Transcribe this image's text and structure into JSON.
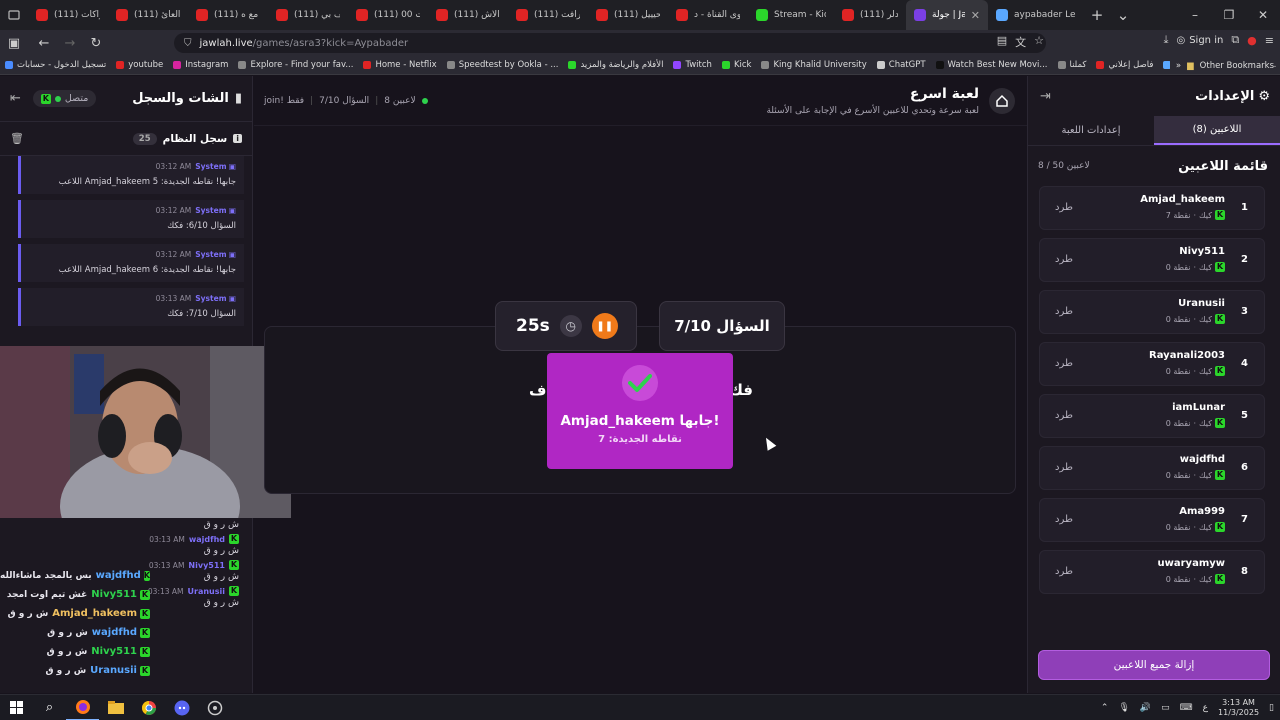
{
  "browser": {
    "tabs": [
      {
        "label": "(111) الاشتراكات",
        "type": "yt"
      },
      {
        "label": "(111) قصة العائ",
        "type": "yt"
      },
      {
        "label": "(111) مافيا مع ه",
        "type": "yt"
      },
      {
        "label": "(111) سوالف بي",
        "type": "yt"
      },
      {
        "label": "(111) جمعت 00",
        "type": "yt"
      },
      {
        "label": "(111) أغرب الأش",
        "type": "yt"
      },
      {
        "label": "(111) ماين كرافت",
        "type": "yt"
      },
      {
        "label": "(111) مستحيييل",
        "type": "yt"
      },
      {
        "label": "محتوى القناة - د",
        "type": "yt"
      },
      {
        "label": "Stream - Kick D",
        "type": "kick"
      },
      {
        "label": "(111) ميدلر",
        "type": "yt"
      },
      {
        "label": "جولة | Jawlah",
        "type": "active"
      },
      {
        "label": "aypabader Lea",
        "type": "other"
      }
    ],
    "url_host": "jawlah.live",
    "url_path": "/games/asra3?kick=Aypabader",
    "signin_label": "Sign in",
    "bookmarks": [
      "تسجيل الدخول - حسابات",
      "youtube",
      "Instagram",
      "Explore - Find your fav...",
      "Home - Netflix",
      "Speedtest by Ookla - ...",
      "الأفلام والرياضة والمزيد",
      "Twitch",
      "Kick",
      "King Khalid University",
      "ChatGPT",
      "Watch Best New Movi...",
      "كملنا",
      "فاصل إعلاني",
      "Players | Aternos | Fre..."
    ],
    "other_bookmarks": "Other Bookmarks"
  },
  "chat": {
    "title": "الشات والسجل",
    "status": "متصل",
    "log_title": "سجل النظام",
    "log_count": "25",
    "log_items": [
      {
        "sender": "System",
        "time": "03:12 AM",
        "text": "اللاعب Amjad_hakeem جابها! نقاطه الجديدة: 5"
      },
      {
        "sender": "System",
        "time": "03:12 AM",
        "text": "السؤال 6/10: فكك"
      },
      {
        "sender": "System",
        "time": "03:12 AM",
        "text": "اللاعب Amjad_hakeem جابها! نقاطه الجديدة: 6"
      },
      {
        "sender": "System",
        "time": "03:13 AM",
        "text": "السؤال 7/10: فكك"
      }
    ],
    "messages": [
      {
        "user": "Amjad_hakeem",
        "time": "",
        "text": "ش ر و ق"
      },
      {
        "user": "wajdfhd",
        "time": "03:13 AM",
        "text": "ش ر و ق"
      },
      {
        "user": "Nivy511",
        "time": "03:13 AM",
        "text": "ش ر و ق"
      },
      {
        "user": "Uranusii",
        "time": "03:13 AM",
        "text": "ش ر و ق"
      }
    ],
    "overlay_lines": [
      {
        "user": "wajdfhd",
        "text": "بس يالمجد ماشاءالله",
        "color": "#5aa8ff"
      },
      {
        "user": "Nivy511",
        "text": "غش تيم اوت امجد",
        "color": "#2ed24d"
      },
      {
        "user": "Amjad_hakeem",
        "text": "ش ر و ق",
        "color": "#f0c060"
      },
      {
        "user": "wajdfhd",
        "text": "ش ر و ق",
        "color": "#5aa8ff"
      },
      {
        "user": "Nivy511",
        "text": "ش ر و ق",
        "color": "#2ed24d"
      },
      {
        "user": "Uranusii",
        "text": "ش ر و ق",
        "color": "#5aa8ff"
      }
    ]
  },
  "game": {
    "title": "لعبة اسرع",
    "subtitle": "لعبة سرعة وتحدي للاعبين الأسرع في الإجابة على الأسئلة",
    "stats_players": "8 لاعبين",
    "stats_question": "السؤال 7/10",
    "stats_join": "join! فقط",
    "question_number": "السؤال 7/10",
    "timer": "25s",
    "question_text_right": "فك",
    "question_text_left": "ف:",
    "popup_title": "Amjad_hakeem جابها!",
    "popup_sub": "نقاطه الجديدة: 7",
    "accent_color": "#b027c4"
  },
  "settings": {
    "title": "الإعدادات",
    "tab_players": "اللاعبين (8)",
    "tab_game": "إعدادات اللعبة",
    "list_title": "قائمة اللاعبين",
    "list_count": "8 / 50 لاعبين",
    "kick_label": "طرد",
    "platform_label": "كيك",
    "players": [
      {
        "rank": "1",
        "name": "Amjad_hakeem",
        "points": "7 نقطة"
      },
      {
        "rank": "2",
        "name": "Nivy511",
        "points": "0 نقطة"
      },
      {
        "rank": "3",
        "name": "Uranusii",
        "points": "0 نقطة"
      },
      {
        "rank": "4",
        "name": "Rayanali2003",
        "points": "0 نقطة"
      },
      {
        "rank": "5",
        "name": "iamLunar",
        "points": "0 نقطة"
      },
      {
        "rank": "6",
        "name": "wajdfhd",
        "points": "0 نقطة"
      },
      {
        "rank": "7",
        "name": "Ama999",
        "points": "0 نقطة"
      },
      {
        "rank": "8",
        "name": "uwaryamyw",
        "points": "0 نقطة"
      }
    ],
    "remove_all_label": "إزالة جميع اللاعبين"
  },
  "taskbar": {
    "time": "3:13 AM",
    "date": "11/3/2025",
    "lang": "ع"
  }
}
